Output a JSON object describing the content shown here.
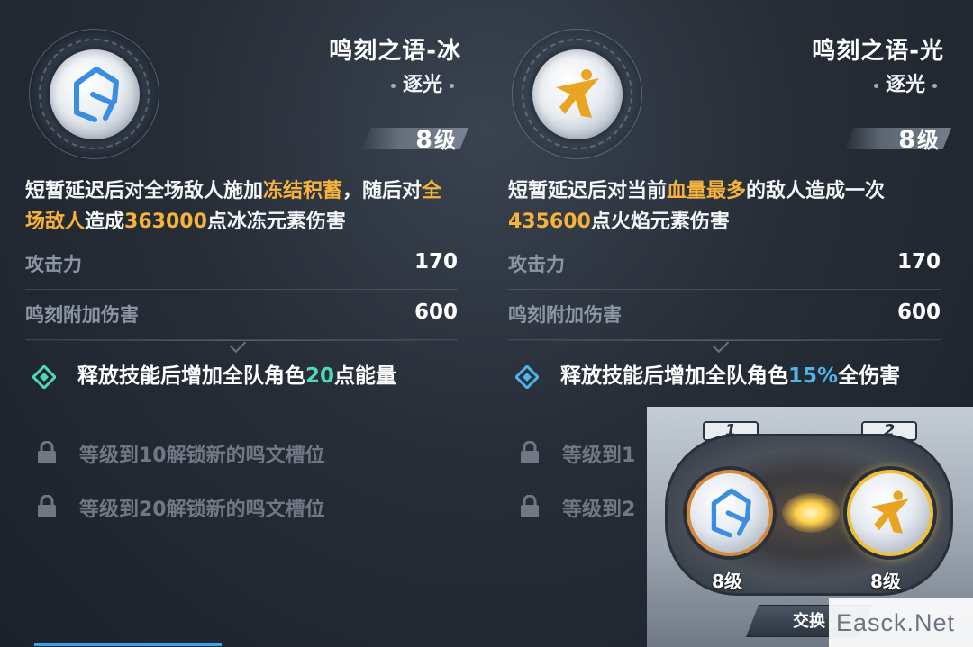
{
  "left_card": {
    "title": "鸣刻之语-冰",
    "subtitle": "逐光",
    "level_num": "8",
    "level_unit": "级",
    "desc_parts": [
      "短暂延迟后对全场敌人施加",
      "冻结积蓄",
      "，随后对",
      "全场敌人",
      "造成",
      "363000",
      "点冰冻元素伤害"
    ],
    "stats": [
      {
        "label": "攻击力",
        "value": "170"
      },
      {
        "label": "鸣刻附加伤害",
        "value": "600"
      }
    ],
    "effect_parts": [
      "释放技能后增加全队角色",
      "20",
      "点能量"
    ],
    "locks": [
      "等级到10解锁新的鸣文槽位",
      "等级到20解锁新的鸣文槽位"
    ],
    "accent_color": "#4fd9b8"
  },
  "right_card": {
    "title": "鸣刻之语-光",
    "subtitle": "逐光",
    "level_num": "8",
    "level_unit": "级",
    "desc_parts": [
      "短暂延迟后对当前",
      "血量最多",
      "的敌人造成一次",
      "435600",
      "点火焰元素伤害"
    ],
    "stats": [
      {
        "label": "攻击力",
        "value": "170"
      },
      {
        "label": "鸣刻附加伤害",
        "value": "600"
      }
    ],
    "effect_parts": [
      "释放技能后增加全队角色",
      "15%",
      "全伤害"
    ],
    "locks": [
      "等级到1",
      "等级到2"
    ],
    "accent_color": "#4fb4e8"
  },
  "swap_panel": {
    "slot1_tag": "1",
    "slot2_tag": "2",
    "slot1_level": "8级",
    "slot2_level": "8级",
    "swap_label": "交换"
  },
  "watermark": "Easck.Net",
  "colors": {
    "highlight": "#f6b23a",
    "ice_glyph": "#3a8ee0",
    "light_glyph": "#e9a422"
  }
}
